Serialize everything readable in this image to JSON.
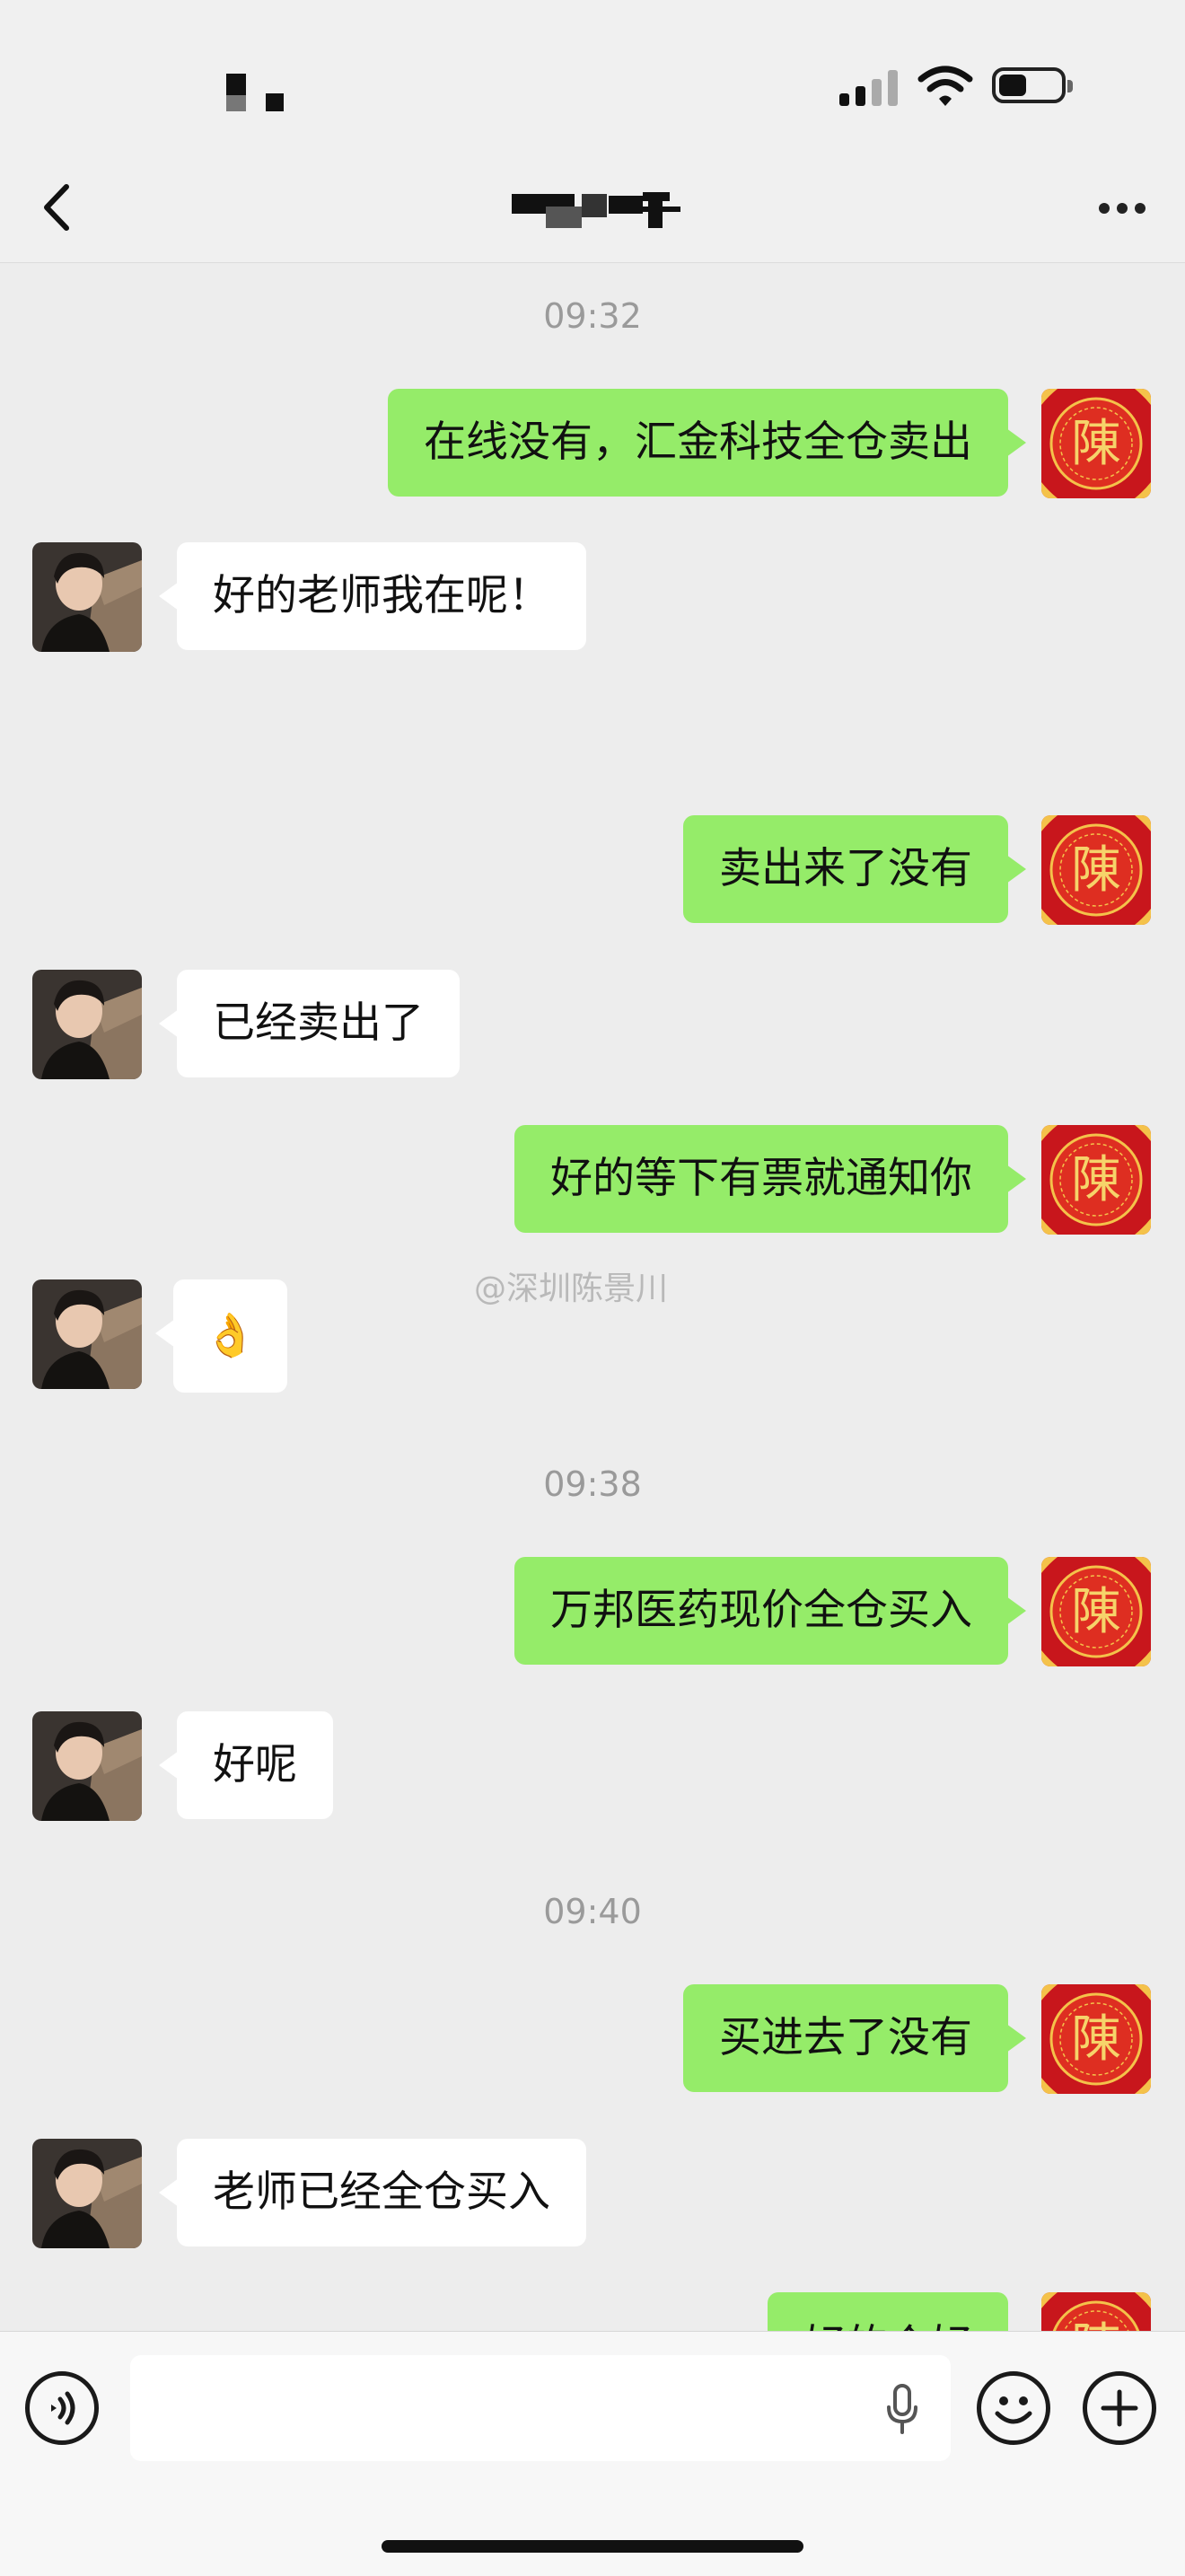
{
  "nav": {
    "back_icon": "chevron-left-icon",
    "more_icon": "ellipsis-icon"
  },
  "status": {
    "signal_icon": "cellular-signal-icon",
    "wifi_icon": "wifi-icon",
    "battery_icon": "battery-icon"
  },
  "messages": [
    {
      "type": "time",
      "text": "09:32"
    },
    {
      "type": "out",
      "text": "在线没有，汇金科技全仓卖出"
    },
    {
      "type": "in",
      "text": "好的老师我在呢！"
    },
    {
      "type": "out",
      "text": "卖出来了没有"
    },
    {
      "type": "in",
      "text": "已经卖出了"
    },
    {
      "type": "out",
      "text": "好的等下有票就通知你"
    },
    {
      "type": "in",
      "text": "👌"
    },
    {
      "type": "time",
      "text": "09:38"
    },
    {
      "type": "out",
      "text": "万邦医药现价全仓买入"
    },
    {
      "type": "in",
      "text": "好呢"
    },
    {
      "type": "time",
      "text": "09:40"
    },
    {
      "type": "out",
      "text": "买进去了没有"
    },
    {
      "type": "in",
      "text": "老师已经全仓买入"
    },
    {
      "type": "out",
      "text": "好的个好"
    }
  ],
  "avatars": {
    "self_glyph": "陳"
  },
  "watermark": "@深圳陈景川",
  "inputbar": {
    "voice_icon": "voice-mode-icon",
    "mic_icon": "microphone-icon",
    "emoji_icon": "emoji-icon",
    "plus_icon": "plus-icon"
  },
  "colors": {
    "outgoing_bubble": "#95ec69",
    "incoming_bubble": "#ffffff",
    "chat_background": "#ededed"
  }
}
